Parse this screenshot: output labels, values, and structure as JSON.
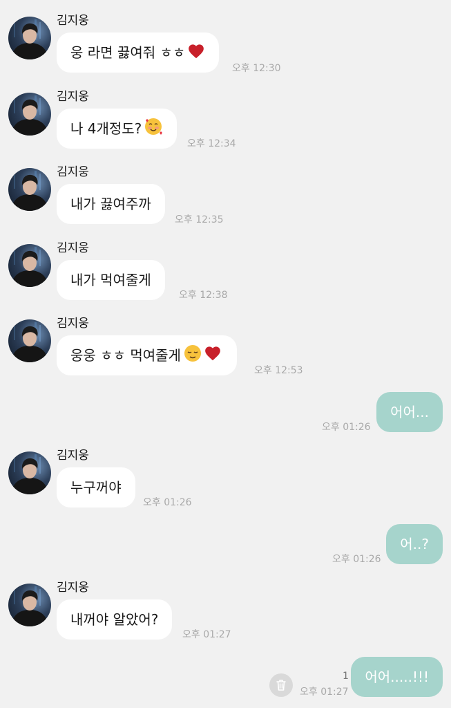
{
  "messages": [
    {
      "sender": "김지웅",
      "text": "웅 라면 끓여줘 ㅎㅎ",
      "emoji": "heart-icon",
      "time": "오후 12:30"
    },
    {
      "sender": "김지웅",
      "text": "나 4개정도?",
      "emoji": "smiling-face-with-hearts-icon",
      "time": "오후 12:34"
    },
    {
      "sender": "김지웅",
      "text": "내가 끓여주까",
      "time": "오후 12:35"
    },
    {
      "sender": "김지웅",
      "text": "내가 먹여줄게",
      "time": "오후 12:38"
    },
    {
      "sender": "김지웅",
      "text": "웅웅 ㅎㅎ 먹여줄게",
      "emoji": "relieved-face-and-heart-icon",
      "time": "오후 12:53"
    },
    {
      "text": "어어...",
      "time": "오후 01:26"
    },
    {
      "sender": "김지웅",
      "text": "누구꺼야",
      "time": "오후 01:26"
    },
    {
      "text": "어..?",
      "time": "오후 01:26"
    },
    {
      "sender": "김지웅",
      "text": "내꺼야 알았어?",
      "time": "오후 01:27"
    },
    {
      "text": "어어.....!!!",
      "time": "오후 01:27",
      "unread": "1"
    }
  ],
  "colors": {
    "background": "#f1f1f1",
    "incoming_bubble": "#ffffff",
    "outgoing_bubble": "#a6d4cc",
    "timestamp": "#a9a9a9"
  }
}
